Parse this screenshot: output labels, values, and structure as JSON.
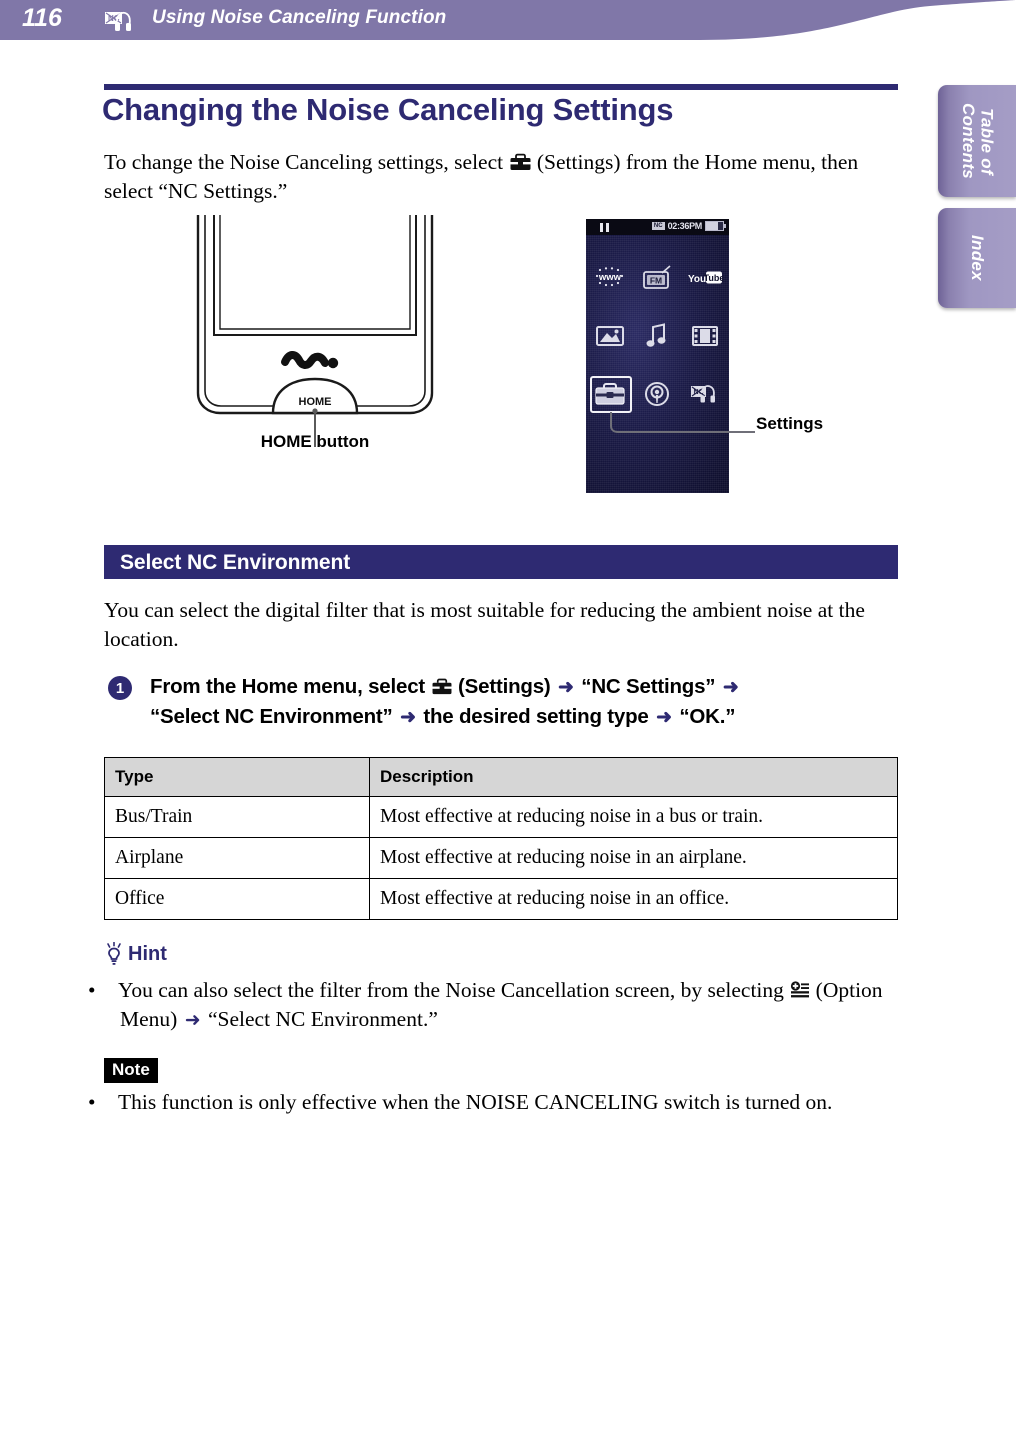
{
  "header": {
    "page_number": "116",
    "icon": "noise-canceling-headphone-icon",
    "title": "Using Noise Canceling Function",
    "bg_color": "#8077a8"
  },
  "side_tabs": [
    {
      "label": "Table of\nContents",
      "line1": "Table of",
      "line2": "Contents",
      "name": "tab-table-of-contents"
    },
    {
      "label": "Index",
      "line1": "Index",
      "line2": "",
      "name": "tab-index"
    }
  ],
  "doc": {
    "title": "Changing the Noise Canceling Settings",
    "title_color": "#2e2a72",
    "intro_before": "To change the Noise Canceling settings, select ",
    "intro_icon": "settings-toolbox-icon",
    "intro_after": " (Settings) from the Home menu, then select “NC Settings.”"
  },
  "figure": {
    "device_caption": "HOME button",
    "home_button_label": "HOME",
    "walkman_logo": "walkman-logo",
    "callout_label": "Settings"
  },
  "screen": {
    "status": {
      "pause_icon": "pause-icon",
      "nc_badge": "NC",
      "time": "02:36PM",
      "battery_icon": "battery-icon"
    },
    "icons": [
      {
        "name": "internet-browser-icon",
        "label": "www",
        "selected": false
      },
      {
        "name": "fm-radio-icon",
        "label": "FM",
        "selected": false
      },
      {
        "name": "youtube-icon",
        "label": "You Tube",
        "selected": false
      },
      {
        "name": "photos-icon",
        "label": "",
        "selected": false
      },
      {
        "name": "music-icon",
        "label": "",
        "selected": false
      },
      {
        "name": "videos-icon",
        "label": "",
        "selected": false
      },
      {
        "name": "settings-toolbox-icon",
        "label": "",
        "selected": true
      },
      {
        "name": "podcast-icon",
        "label": "",
        "selected": false
      },
      {
        "name": "noise-canceling-icon",
        "label": "",
        "selected": false
      }
    ]
  },
  "section": {
    "bar_title": "Select NC Environment",
    "bar_color": "#2e2a72",
    "paragraph": "You can select the digital filter that is most suitable for reducing the ambient noise at the location."
  },
  "step": {
    "number": "1",
    "part1": "From the Home menu, select ",
    "icon": "settings-toolbox-icon",
    "part2": " (Settings) ",
    "arrow": "➜",
    "part3": " “NC Settings” ",
    "part4": " “Select NC Environment” ",
    "part5": " the desired setting type ",
    "part6": " “OK.”"
  },
  "table": {
    "headers": [
      "Type",
      "Description"
    ],
    "rows": [
      [
        "Bus/Train",
        "Most effective at reducing noise in a bus or train."
      ],
      [
        "Airplane",
        "Most effective at reducing noise in an airplane."
      ],
      [
        "Office",
        "Most effective at reducing noise in an office."
      ]
    ]
  },
  "hint": {
    "label": "Hint",
    "icon": "lightbulb-icon",
    "bullet": "•",
    "text_before": "You can also select the filter from the Noise Cancellation screen, by selecting ",
    "text_icon": "option-menu-icon",
    "text_mid": " (Option Menu) ",
    "arrow": "➜",
    "text_after": " “Select NC Environment.”"
  },
  "note": {
    "label": "Note",
    "bullet": "•",
    "text": "This function is only effective when the NOISE CANCELING switch is turned on."
  }
}
